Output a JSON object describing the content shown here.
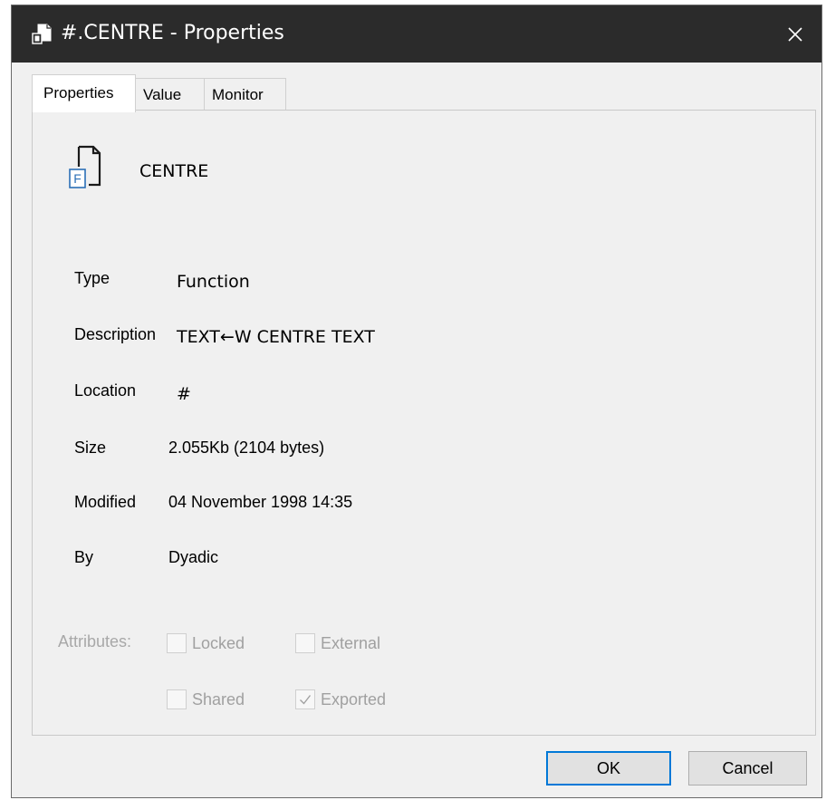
{
  "window": {
    "title": "#.CENTRE - Properties",
    "title_icon": "function-file-icon",
    "close_icon": "close-icon"
  },
  "tabs": [
    {
      "label": "Properties",
      "active": true
    },
    {
      "label": "Value",
      "active": false
    },
    {
      "label": "Monitor",
      "active": false
    }
  ],
  "object": {
    "icon": "function-file-icon",
    "icon_letter": "F",
    "name": "CENTRE"
  },
  "properties": {
    "type": {
      "label": "Type",
      "value": "Function"
    },
    "description": {
      "label": "Description",
      "value": "TEXT←W CENTRE TEXT"
    },
    "location": {
      "label": "Location",
      "value": "#"
    },
    "size": {
      "label": "Size",
      "value": "2.055Kb (2104 bytes)"
    },
    "modified": {
      "label": "Modified",
      "value": "04 November 1998 14:35"
    },
    "by": {
      "label": "By",
      "value": "Dyadic"
    }
  },
  "attributes": {
    "label": "Attributes:",
    "locked": {
      "label": "Locked",
      "checked": false
    },
    "external": {
      "label": "External",
      "checked": false
    },
    "shared": {
      "label": "Shared",
      "checked": false
    },
    "exported": {
      "label": "Exported",
      "checked": true
    }
  },
  "buttons": {
    "ok": "OK",
    "cancel": "Cancel"
  },
  "colors": {
    "titlebar": "#2b2b2b",
    "dialog_bg": "#f0f0f0",
    "disabled_text": "#a0a0a0",
    "default_button_border": "#0078d7"
  }
}
